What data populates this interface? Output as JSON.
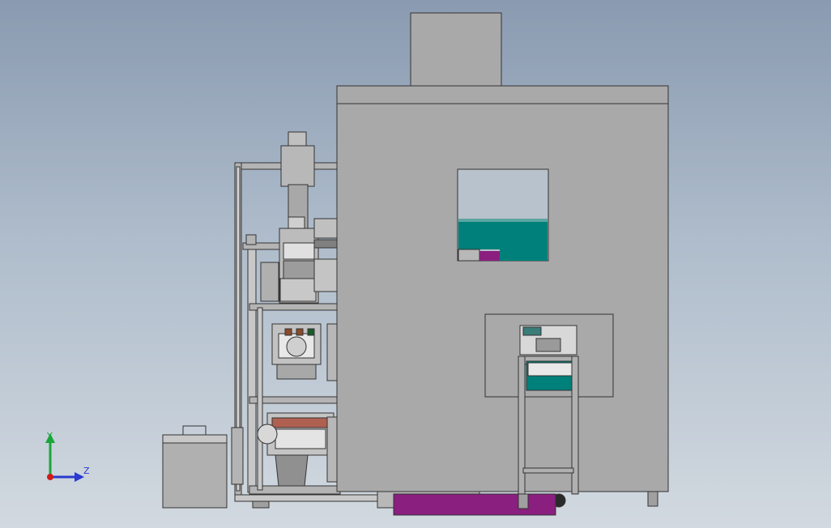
{
  "viewport": {
    "background_top": "#8a9ab0",
    "background_bottom": "#d2d9e0"
  },
  "model": {
    "cabinet_color": "#a9a9a9",
    "frame_color": "#b4b4b4",
    "teal_color": "#00807a",
    "purple_color": "#8a1f7f",
    "window_glass_color": "#b8c2cc"
  },
  "triad": {
    "y_label": "Y",
    "z_label": "Z",
    "y_color": "#1aa63a",
    "z_color": "#2a3ad0",
    "origin_color": "#d01a1a"
  }
}
